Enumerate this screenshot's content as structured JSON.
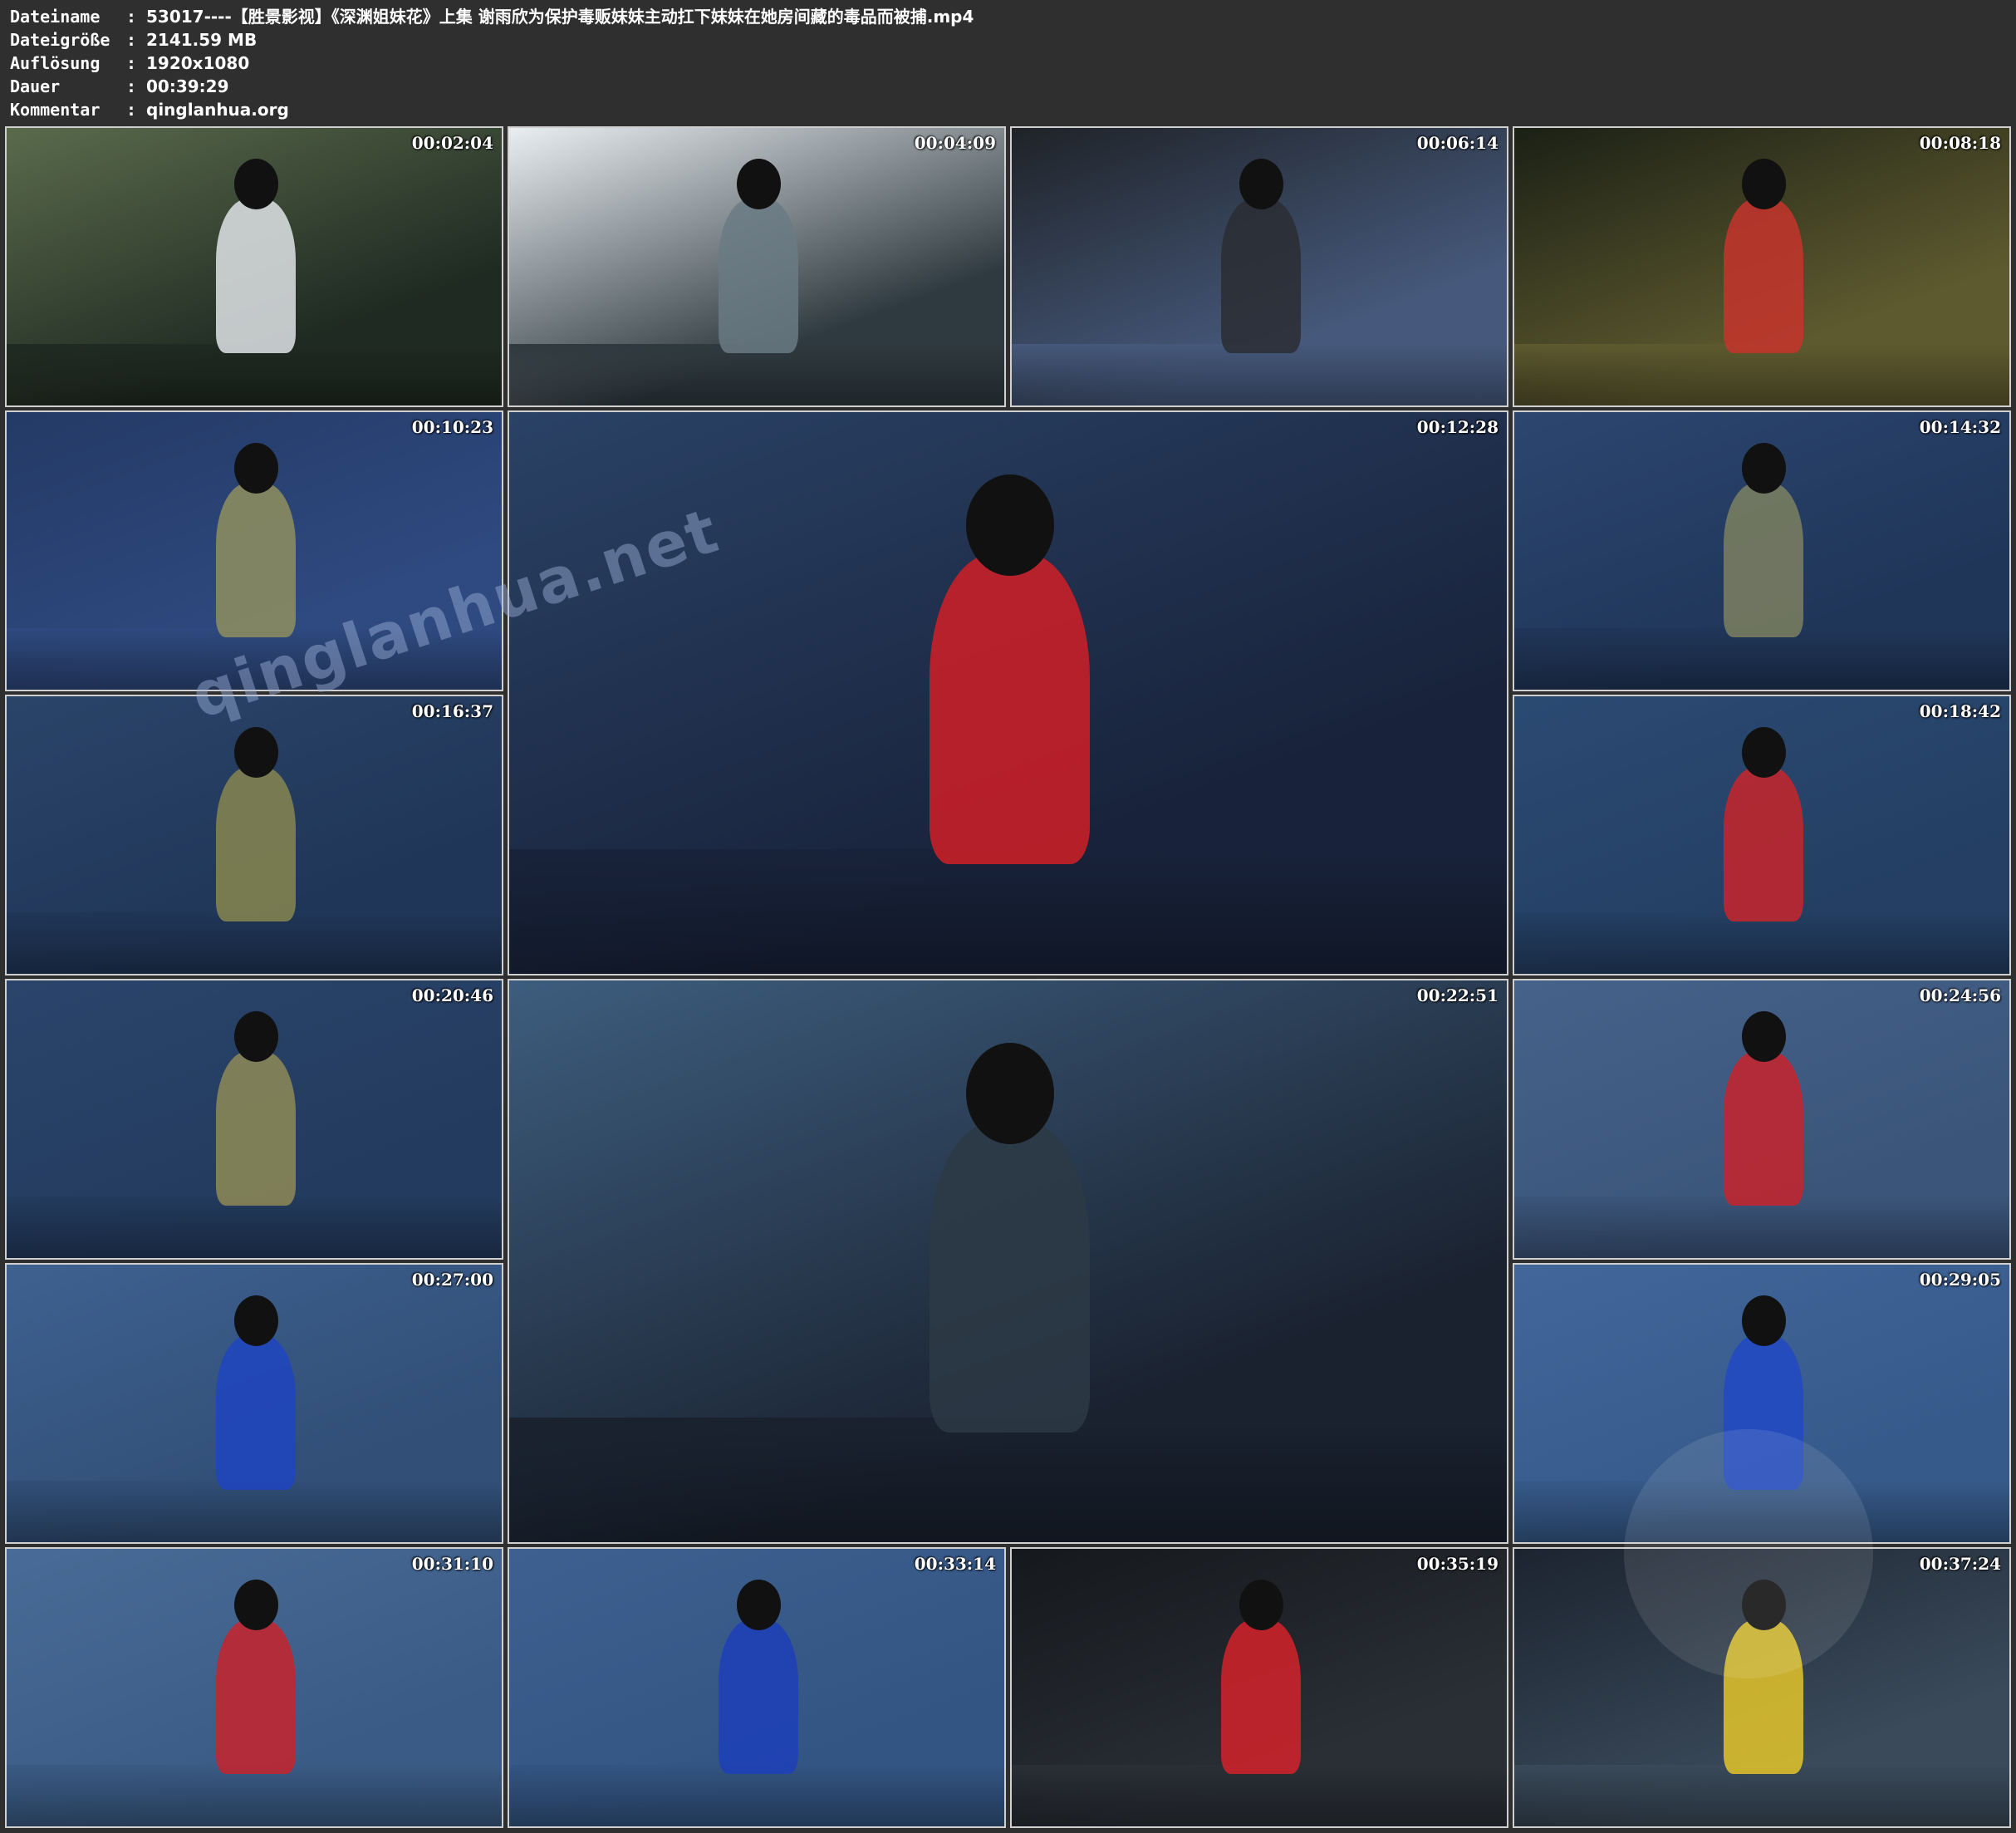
{
  "header": {
    "rows": [
      {
        "key": "Dateiname",
        "value": "53017----【胜景影视】《深渊姐妹花》上集 谢雨欣为保护毒贩妹妹主动扛下妹妹在她房间藏的毒品而被捕.mp4"
      },
      {
        "key": "Dateigröße",
        "value": "2141.59 MB"
      },
      {
        "key": "Auflösung",
        "value": "1920x1080"
      },
      {
        "key": "Dauer",
        "value": "00:39:29"
      },
      {
        "key": "Kommentar",
        "value": "qinglanhua.org"
      }
    ],
    "separator": ":"
  },
  "watermark": "qinglanhua.net",
  "thumbnails": [
    {
      "time": "00:02:04",
      "palette": [
        "#5a6b4c",
        "#1f2a22",
        "#dfe3e6"
      ]
    },
    {
      "time": "00:04:09",
      "palette": [
        "#e9eef1",
        "#2f3a40",
        "#6a7a84"
      ]
    },
    {
      "time": "00:06:14",
      "palette": [
        "#1f2328",
        "#46597c",
        "#2a2d33"
      ]
    },
    {
      "time": "00:08:18",
      "palette": [
        "#1b2015",
        "#5e5a2f",
        "#c6342c"
      ]
    },
    {
      "time": "00:10:23",
      "palette": [
        "#243a66",
        "#2f4a80",
        "#8f8f5e"
      ]
    },
    {
      "time": "00:12:28",
      "palette": [
        "#2a4266",
        "#18223a",
        "#d11f26"
      ]
    },
    {
      "time": "00:14:32",
      "palette": [
        "#2c4670",
        "#203659",
        "#7c8060"
      ]
    },
    {
      "time": "00:16:37",
      "palette": [
        "#2a4469",
        "#203658",
        "#87864f"
      ]
    },
    {
      "time": "00:18:42",
      "palette": [
        "#2b4a73",
        "#243f63",
        "#c8252a"
      ]
    },
    {
      "time": "00:20:46",
      "palette": [
        "#2a446b",
        "#233b5e",
        "#8e8a56"
      ]
    },
    {
      "time": "00:22:51",
      "palette": [
        "#3d5d7e",
        "#1a2230",
        "#2d3945"
      ]
    },
    {
      "time": "00:24:56",
      "palette": [
        "#46628a",
        "#3b557a",
        "#c8232b"
      ]
    },
    {
      "time": "00:27:00",
      "palette": [
        "#3e6190",
        "#314f77",
        "#1f44c0"
      ]
    },
    {
      "time": "00:29:05",
      "palette": [
        "#42669a",
        "#365a8a",
        "#2149c4"
      ]
    },
    {
      "time": "00:31:10",
      "palette": [
        "#486b97",
        "#3a5b85",
        "#c8232b"
      ]
    },
    {
      "time": "00:33:14",
      "palette": [
        "#3e6090",
        "#335583",
        "#1d3fba"
      ]
    },
    {
      "time": "00:35:19",
      "palette": [
        "#15181c",
        "#2a2f36",
        "#d5222a"
      ]
    },
    {
      "time": "00:37:24",
      "palette": [
        "#1c2430",
        "#3a4a5a",
        "#e4c52a"
      ]
    }
  ]
}
